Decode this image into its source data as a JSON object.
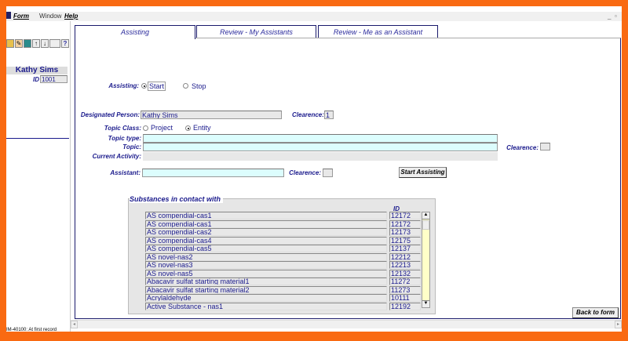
{
  "menu": {
    "form": "Form",
    "window": "Window",
    "help": "Help"
  },
  "window_controls": {
    "minimize": "_",
    "restore": "▫"
  },
  "toolbar": [
    "save",
    "edit",
    "exit",
    "↑",
    "↓",
    "",
    "?"
  ],
  "left": {
    "name": "Kathy Sims",
    "id_label": "ID",
    "id_value": "1001"
  },
  "tabs": [
    {
      "label": "Assisting",
      "active": true
    },
    {
      "label": "Review - My Assistants",
      "active": false
    },
    {
      "label": "Review - Me as an Assistant",
      "active": false
    }
  ],
  "form": {
    "assisting_label": "Assisting:",
    "start": "Start",
    "stop": "Stop",
    "assisting_selected": "Start",
    "designated_label": "Designated Person:",
    "designated_value": "Kathy Sims",
    "clearence_label": "Clearence:",
    "designated_clearence": "1",
    "topic_class_label": "Topic Class:",
    "project": "Project",
    "entity": "Entity",
    "topic_class_selected": "Entity",
    "topic_type_label": "Topic type:",
    "topic_type_value": "",
    "topic_label": "Topic:",
    "topic_value": "",
    "topic_clearence": "",
    "current_activity_label": "Current Activity:",
    "current_activity_value": "",
    "assistant_label": "Assistant:",
    "assistant_value": "",
    "assistant_clearence": "",
    "start_button": "Start Assisting"
  },
  "substances": {
    "title": "Substances in contact with",
    "id_header": "ID",
    "rows": [
      {
        "name": "AS compendial-cas1",
        "id": "12172"
      },
      {
        "name": "AS compendial-cas1",
        "id": "12172"
      },
      {
        "name": "AS compendial-cas2",
        "id": "12173"
      },
      {
        "name": "AS compendial-cas4",
        "id": "12175"
      },
      {
        "name": "AS compendial-cas5",
        "id": "12137"
      },
      {
        "name": "AS novel-nas2",
        "id": "12212"
      },
      {
        "name": "AS novel-nas3",
        "id": "12213"
      },
      {
        "name": "AS novel-nas5",
        "id": "12132"
      },
      {
        "name": "Abacavir sulfat starting material1",
        "id": "11272"
      },
      {
        "name": "Abacavir sulfat starting material2",
        "id": "11273"
      },
      {
        "name": "Acrylaldehyde",
        "id": "10111"
      },
      {
        "name": "Active Substance - nas1",
        "id": "12192"
      }
    ]
  },
  "back_button": "Back to form",
  "status": "IM-40100: At first record",
  "colors": {
    "frame": "#f96a12",
    "text": "#1a1a8c",
    "input": "#dcfdfd",
    "scroll_track": "#ffffc8"
  }
}
